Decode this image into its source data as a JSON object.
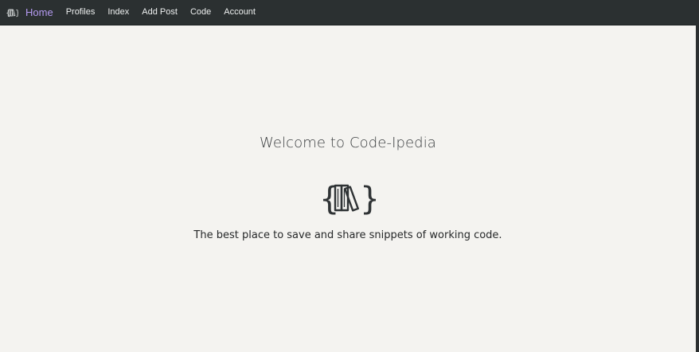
{
  "nav": {
    "logo_icon": "code-books-logo-icon",
    "items": [
      {
        "label": "Home",
        "active": true
      },
      {
        "label": "Profiles",
        "active": false
      },
      {
        "label": "Index",
        "active": false
      },
      {
        "label": "Add Post",
        "active": false
      },
      {
        "label": "Code",
        "active": false
      },
      {
        "label": "Account",
        "active": false
      }
    ],
    "active_color": "#b59bf2",
    "text_color": "#eef0f0",
    "background": "#2b3031"
  },
  "hero": {
    "title": "Welcome to Code-Ipedia",
    "icon": "code-books-icon",
    "tagline": "The best place to save and share snippets of working code."
  },
  "colors": {
    "content_background": "#f4f3f0",
    "title_text": "#3b3e40",
    "tagline_text": "#262829"
  }
}
